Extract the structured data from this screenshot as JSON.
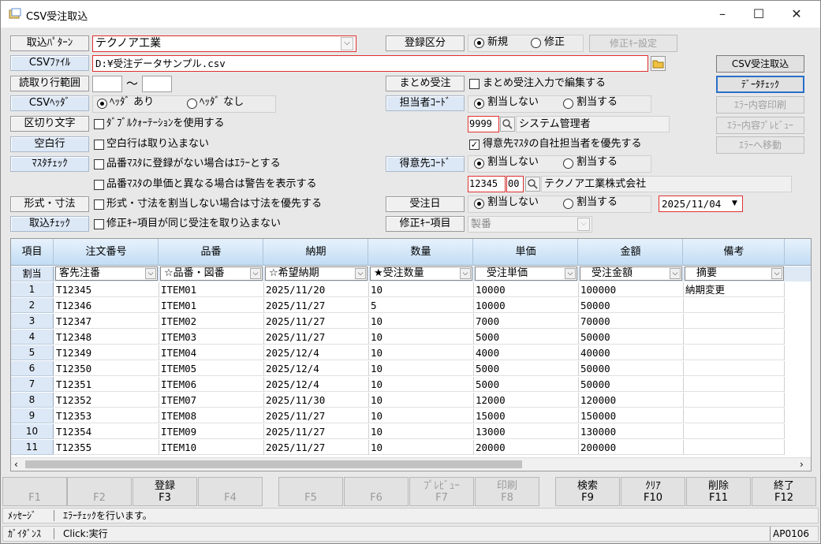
{
  "window": {
    "title": "CSV受注取込",
    "min": "–",
    "max": "☐",
    "close": "✕"
  },
  "form": {
    "import_pattern_label": "取込ﾊﾟﾀｰﾝ",
    "import_pattern_value": "テクノア工業",
    "csv_file_label": "CSVﾌｧｲﾙ",
    "csv_file_value": "D:¥受注データサンプル.csv",
    "read_range_label": "読取り行範囲",
    "range_sep": "～",
    "csv_header_label": "CSVﾍｯﾀﾞ",
    "header_yes": "ﾍｯﾀﾞ あり",
    "header_no": "ﾍｯﾀﾞ なし",
    "delimiter_label": "区切り文字",
    "double_quote": "ﾀﾞﾌﾞﾙｸｫｰﾃｰｼｮﾝを使用する",
    "blank_row_label": "空白行",
    "blank_row_opt": "空白行は取り込まない",
    "master_check_label": "ﾏｽﾀﾁｪｯｸ",
    "master_check_opt1": "品番ﾏｽﾀに登録がない場合はｴﾗｰとする",
    "master_check_opt2": "品番ﾏｽﾀの単価と異なる場合は警告を表示する",
    "shape_label": "形式・寸法",
    "shape_opt": "形式・寸法を割当しない場合は寸法を優先する",
    "import_check_label": "取込ﾁｪｯｸ",
    "import_check_opt": "修正ｷｰ項目が同じ受注を取り込まない",
    "reg_type_label": "登録区分",
    "reg_new": "新規",
    "reg_edit": "修正",
    "edit_key_btn": "修正ｷｰ設定",
    "summary_label": "まとめ受注",
    "summary_opt": "まとめ受注入力で編集する",
    "staff_code_label": "担当者ｺｰﾄﾞ",
    "no_assign": "割当しない",
    "assign": "割当する",
    "staff_code_value": "9999",
    "staff_name": "システム管理者",
    "prefer_customer_staff": "得意先ﾏｽﾀの自社担当者を優先する",
    "customer_code_label": "得意先ｺｰﾄﾞ",
    "customer_code_value": "12345",
    "customer_sub_value": "00",
    "customer_name": "テクノア工業株式会社",
    "order_date_label": "受注日",
    "order_date_value": "2025/11/04",
    "edit_key_item_label": "修正ｷｰ項目",
    "edit_key_item_value": "製番"
  },
  "side_buttons": {
    "csv_import": "CSV受注取込",
    "data_check": "ﾃﾞｰﾀﾁｪｯｸ",
    "error_print": "ｴﾗｰ内容印刷",
    "error_preview": "ｴﾗｰ内容ﾌﾟﾚﾋﾞｭｰ",
    "error_move": "ｴﾗｰへ移動"
  },
  "grid": {
    "headers": [
      "項目",
      "注文番号",
      "品番",
      "納期",
      "数量",
      "単価",
      "金額",
      "備考"
    ],
    "assign_label": "割当",
    "assign_values": [
      "客先注番",
      "☆品番・図番",
      "☆希望納期",
      "★受注数量",
      "受注単価",
      "受注金額",
      "摘要"
    ],
    "rows": [
      {
        "n": "1",
        "order": "T12345",
        "item": "ITEM01",
        "due": "2025/11/20",
        "qty": "10",
        "price": "10000",
        "amount": "100000",
        "note": "納期変更"
      },
      {
        "n": "2",
        "order": "T12346",
        "item": "ITEM01",
        "due": "2025/11/27",
        "qty": "5",
        "price": "10000",
        "amount": "50000",
        "note": ""
      },
      {
        "n": "3",
        "order": "T12347",
        "item": "ITEM02",
        "due": "2025/11/27",
        "qty": "10",
        "price": "7000",
        "amount": "70000",
        "note": ""
      },
      {
        "n": "4",
        "order": "T12348",
        "item": "ITEM03",
        "due": "2025/11/27",
        "qty": "10",
        "price": "5000",
        "amount": "50000",
        "note": ""
      },
      {
        "n": "5",
        "order": "T12349",
        "item": "ITEM04",
        "due": "2025/12/4",
        "qty": "10",
        "price": "4000",
        "amount": "40000",
        "note": ""
      },
      {
        "n": "6",
        "order": "T12350",
        "item": "ITEM05",
        "due": "2025/12/4",
        "qty": "10",
        "price": "5000",
        "amount": "50000",
        "note": ""
      },
      {
        "n": "7",
        "order": "T12351",
        "item": "ITEM06",
        "due": "2025/12/4",
        "qty": "10",
        "price": "5000",
        "amount": "50000",
        "note": ""
      },
      {
        "n": "8",
        "order": "T12352",
        "item": "ITEM07",
        "due": "2025/11/30",
        "qty": "10",
        "price": "12000",
        "amount": "120000",
        "note": ""
      },
      {
        "n": "9",
        "order": "T12353",
        "item": "ITEM08",
        "due": "2025/11/27",
        "qty": "10",
        "price": "15000",
        "amount": "150000",
        "note": ""
      },
      {
        "n": "10",
        "order": "T12354",
        "item": "ITEM09",
        "due": "2025/11/27",
        "qty": "10",
        "price": "13000",
        "amount": "130000",
        "note": ""
      },
      {
        "n": "11",
        "order": "T12355",
        "item": "ITEM10",
        "due": "2025/11/27",
        "qty": "10",
        "price": "20000",
        "amount": "200000",
        "note": ""
      }
    ]
  },
  "fkeys": [
    {
      "top": "",
      "key": "F1"
    },
    {
      "top": "",
      "key": "F2"
    },
    {
      "top": "登録",
      "key": "F3"
    },
    {
      "top": "",
      "key": "F4"
    },
    {
      "top": "",
      "key": "F5"
    },
    {
      "top": "",
      "key": "F6"
    },
    {
      "top": "ﾌﾟﾚﾋﾞｭｰ",
      "key": "F7"
    },
    {
      "top": "印刷",
      "key": "F8"
    },
    {
      "top": "検索",
      "key": "F9"
    },
    {
      "top": "ｸﾘｱ",
      "key": "F10"
    },
    {
      "top": "削除",
      "key": "F11"
    },
    {
      "top": "終了",
      "key": "F12"
    }
  ],
  "status": {
    "message_label": "ﾒｯｾｰｼﾞ",
    "message": "ｴﾗｰﾁｪｯｸを行います。",
    "guidance_label": "ｶﾞｲﾀﾞﾝｽ",
    "guidance": "Click:実行",
    "screen_id": "AP0106"
  }
}
